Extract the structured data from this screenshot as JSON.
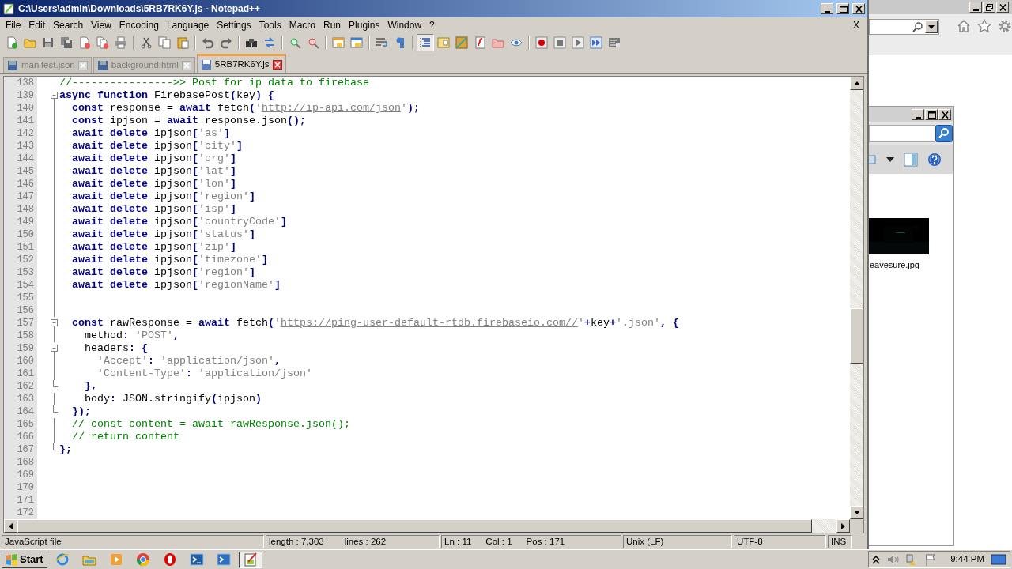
{
  "window": {
    "title": "C:\\Users\\admin\\Downloads\\5RB7RK6Y.js - Notepad++"
  },
  "menu": [
    "File",
    "Edit",
    "Search",
    "View",
    "Encoding",
    "Language",
    "Settings",
    "Tools",
    "Macro",
    "Run",
    "Plugins",
    "Window",
    "?"
  ],
  "menu_close": "X",
  "toolbar": [
    {
      "pressed": false
    },
    {
      "pressed": false
    },
    {
      "pressed": false
    },
    {
      "pressed": false
    },
    {
      "pressed": false
    },
    {
      "pressed": false
    },
    {
      "pressed": false
    },
    {
      "pressed": false
    },
    {
      "pressed": false
    },
    {
      "pressed": false
    },
    {
      "pressed": false
    },
    {
      "pressed": false
    },
    {
      "pressed": false
    },
    {
      "pressed": false
    },
    {
      "pressed": false
    },
    {
      "pressed": false
    },
    {
      "pressed": false
    },
    {
      "pressed": false
    },
    {
      "pressed": false
    },
    {
      "pressed": false
    },
    {
      "pressed": true
    },
    {
      "pressed": false
    },
    {
      "pressed": false
    },
    {
      "pressed": false
    },
    {
      "pressed": false
    },
    {
      "pressed": false
    },
    {
      "pressed": false
    },
    {
      "pressed": false
    },
    {
      "pressed": false
    },
    {
      "pressed": false
    },
    {
      "pressed": false
    }
  ],
  "tabs": [
    {
      "label": "manifest.json",
      "selected": false
    },
    {
      "label": "background.html",
      "selected": false
    },
    {
      "label": "5RB7RK6Y.js",
      "selected": true
    }
  ],
  "editor": {
    "lines": [
      {
        "num": "138",
        "kind": "plain",
        "tokens": [
          {
            "kind": "comment",
            "text": "//---------------->> Post for ip data to firebase"
          }
        ]
      },
      {
        "num": "139",
        "kind": "start",
        "tokens": [
          {
            "kind": "keyword",
            "text": "async "
          },
          {
            "kind": "keyword",
            "text": "function"
          },
          {
            "kind": "plain",
            "text": " FirebasePost"
          },
          {
            "kind": "operator",
            "text": "("
          },
          {
            "kind": "plain",
            "text": "key"
          },
          {
            "kind": "operator",
            "text": ") {"
          }
        ]
      },
      {
        "num": "140",
        "kind": "inner",
        "tokens": [
          {
            "kind": "keyword",
            "text": "  const"
          },
          {
            "kind": "plain",
            "text": " response = "
          },
          {
            "kind": "keyword",
            "text": "await"
          },
          {
            "kind": "plain",
            "text": " fetch"
          },
          {
            "kind": "operator",
            "text": "("
          },
          {
            "kind": "string",
            "text": "'"
          },
          {
            "kind": "url",
            "text": "http://ip-api.com/json"
          },
          {
            "kind": "string",
            "text": "'"
          },
          {
            "kind": "operator",
            "text": ");"
          }
        ]
      },
      {
        "num": "141",
        "kind": "inner",
        "tokens": [
          {
            "kind": "keyword",
            "text": "  const"
          },
          {
            "kind": "plain",
            "text": " ipjson = "
          },
          {
            "kind": "keyword",
            "text": "await"
          },
          {
            "kind": "plain",
            "text": " response.json"
          },
          {
            "kind": "operator",
            "text": "();"
          }
        ]
      },
      {
        "num": "142",
        "kind": "inner",
        "tokens": [
          {
            "kind": "keyword",
            "text": "  await "
          },
          {
            "kind": "keyword",
            "text": "delete"
          },
          {
            "kind": "plain",
            "text": " ipjson"
          },
          {
            "kind": "operator",
            "text": "["
          },
          {
            "kind": "string",
            "text": "'as'"
          },
          {
            "kind": "operator",
            "text": "]"
          }
        ]
      },
      {
        "num": "143",
        "kind": "inner",
        "tokens": [
          {
            "kind": "keyword",
            "text": "  await "
          },
          {
            "kind": "keyword",
            "text": "delete"
          },
          {
            "kind": "plain",
            "text": " ipjson"
          },
          {
            "kind": "operator",
            "text": "["
          },
          {
            "kind": "string",
            "text": "'city'"
          },
          {
            "kind": "operator",
            "text": "]"
          }
        ]
      },
      {
        "num": "144",
        "kind": "inner",
        "tokens": [
          {
            "kind": "keyword",
            "text": "  await "
          },
          {
            "kind": "keyword",
            "text": "delete"
          },
          {
            "kind": "plain",
            "text": " ipjson"
          },
          {
            "kind": "operator",
            "text": "["
          },
          {
            "kind": "string",
            "text": "'org'"
          },
          {
            "kind": "operator",
            "text": "]"
          }
        ]
      },
      {
        "num": "145",
        "kind": "inner",
        "tokens": [
          {
            "kind": "keyword",
            "text": "  await "
          },
          {
            "kind": "keyword",
            "text": "delete"
          },
          {
            "kind": "plain",
            "text": " ipjson"
          },
          {
            "kind": "operator",
            "text": "["
          },
          {
            "kind": "string",
            "text": "'lat'"
          },
          {
            "kind": "operator",
            "text": "]"
          }
        ]
      },
      {
        "num": "146",
        "kind": "inner",
        "tokens": [
          {
            "kind": "keyword",
            "text": "  await "
          },
          {
            "kind": "keyword",
            "text": "delete"
          },
          {
            "kind": "plain",
            "text": " ipjson"
          },
          {
            "kind": "operator",
            "text": "["
          },
          {
            "kind": "string",
            "text": "'lon'"
          },
          {
            "kind": "operator",
            "text": "]"
          }
        ]
      },
      {
        "num": "147",
        "kind": "inner",
        "tokens": [
          {
            "kind": "keyword",
            "text": "  await "
          },
          {
            "kind": "keyword",
            "text": "delete"
          },
          {
            "kind": "plain",
            "text": " ipjson"
          },
          {
            "kind": "operator",
            "text": "["
          },
          {
            "kind": "string",
            "text": "'region'"
          },
          {
            "kind": "operator",
            "text": "]"
          }
        ]
      },
      {
        "num": "148",
        "kind": "inner",
        "tokens": [
          {
            "kind": "keyword",
            "text": "  await "
          },
          {
            "kind": "keyword",
            "text": "delete"
          },
          {
            "kind": "plain",
            "text": " ipjson"
          },
          {
            "kind": "operator",
            "text": "["
          },
          {
            "kind": "string",
            "text": "'isp'"
          },
          {
            "kind": "operator",
            "text": "]"
          }
        ]
      },
      {
        "num": "149",
        "kind": "inner",
        "tokens": [
          {
            "kind": "keyword",
            "text": "  await "
          },
          {
            "kind": "keyword",
            "text": "delete"
          },
          {
            "kind": "plain",
            "text": " ipjson"
          },
          {
            "kind": "operator",
            "text": "["
          },
          {
            "kind": "string",
            "text": "'countryCode'"
          },
          {
            "kind": "operator",
            "text": "]"
          }
        ]
      },
      {
        "num": "150",
        "kind": "inner",
        "tokens": [
          {
            "kind": "keyword",
            "text": "  await "
          },
          {
            "kind": "keyword",
            "text": "delete"
          },
          {
            "kind": "plain",
            "text": " ipjson"
          },
          {
            "kind": "operator",
            "text": "["
          },
          {
            "kind": "string",
            "text": "'status'"
          },
          {
            "kind": "operator",
            "text": "]"
          }
        ]
      },
      {
        "num": "151",
        "kind": "inner",
        "tokens": [
          {
            "kind": "keyword",
            "text": "  await "
          },
          {
            "kind": "keyword",
            "text": "delete"
          },
          {
            "kind": "plain",
            "text": " ipjson"
          },
          {
            "kind": "operator",
            "text": "["
          },
          {
            "kind": "string",
            "text": "'zip'"
          },
          {
            "kind": "operator",
            "text": "]"
          }
        ]
      },
      {
        "num": "152",
        "kind": "inner",
        "tokens": [
          {
            "kind": "keyword",
            "text": "  await "
          },
          {
            "kind": "keyword",
            "text": "delete"
          },
          {
            "kind": "plain",
            "text": " ipjson"
          },
          {
            "kind": "operator",
            "text": "["
          },
          {
            "kind": "string",
            "text": "'timezone'"
          },
          {
            "kind": "operator",
            "text": "]"
          }
        ]
      },
      {
        "num": "153",
        "kind": "inner",
        "tokens": [
          {
            "kind": "keyword",
            "text": "  await "
          },
          {
            "kind": "keyword",
            "text": "delete"
          },
          {
            "kind": "plain",
            "text": " ipjson"
          },
          {
            "kind": "operator",
            "text": "["
          },
          {
            "kind": "string",
            "text": "'region'"
          },
          {
            "kind": "operator",
            "text": "]"
          }
        ]
      },
      {
        "num": "154",
        "kind": "inner",
        "tokens": [
          {
            "kind": "keyword",
            "text": "  await "
          },
          {
            "kind": "keyword",
            "text": "delete"
          },
          {
            "kind": "plain",
            "text": " ipjson"
          },
          {
            "kind": "operator",
            "text": "["
          },
          {
            "kind": "string",
            "text": "'regionName'"
          },
          {
            "kind": "operator",
            "text": "]"
          }
        ]
      },
      {
        "num": "155",
        "kind": "inner"
      },
      {
        "num": "156",
        "kind": "inner"
      },
      {
        "num": "157",
        "kind": "start",
        "tokens": [
          {
            "kind": "keyword",
            "text": "  const"
          },
          {
            "kind": "plain",
            "text": " rawResponse = "
          },
          {
            "kind": "keyword",
            "text": "await"
          },
          {
            "kind": "plain",
            "text": " fetch"
          },
          {
            "kind": "operator",
            "text": "("
          },
          {
            "kind": "string",
            "text": "'"
          },
          {
            "kind": "url",
            "text": "https://ping-user-default-rtdb.firebaseio.com//"
          },
          {
            "kind": "string",
            "text": "'"
          },
          {
            "kind": "operator",
            "text": "+"
          },
          {
            "kind": "plain",
            "text": "key"
          },
          {
            "kind": "operator",
            "text": "+"
          },
          {
            "kind": "string",
            "text": "'.json'"
          },
          {
            "kind": "operator",
            "text": ", {"
          }
        ]
      },
      {
        "num": "158",
        "kind": "inner",
        "tokens": [
          {
            "kind": "plain",
            "text": "    method"
          },
          {
            "kind": "operator",
            "text": ": "
          },
          {
            "kind": "string",
            "text": "'POST'"
          },
          {
            "kind": "operator",
            "text": ","
          }
        ]
      },
      {
        "num": "159",
        "kind": "start",
        "tokens": [
          {
            "kind": "plain",
            "text": "    headers"
          },
          {
            "kind": "operator",
            "text": ": {"
          }
        ]
      },
      {
        "num": "160",
        "kind": "inner",
        "tokens": [
          {
            "kind": "string",
            "text": "      'Accept'"
          },
          {
            "kind": "operator",
            "text": ": "
          },
          {
            "kind": "string",
            "text": "'application/json'"
          },
          {
            "kind": "operator",
            "text": ","
          }
        ]
      },
      {
        "num": "161",
        "kind": "inner",
        "tokens": [
          {
            "kind": "string",
            "text": "      'Content-Type'"
          },
          {
            "kind": "operator",
            "text": ": "
          },
          {
            "kind": "string",
            "text": "'application/json'"
          }
        ]
      },
      {
        "num": "162",
        "kind": "end",
        "tokens": [
          {
            "kind": "operator",
            "text": "    },"
          }
        ]
      },
      {
        "num": "163",
        "kind": "inner",
        "tokens": [
          {
            "kind": "plain",
            "text": "    body"
          },
          {
            "kind": "operator",
            "text": ":"
          },
          {
            "kind": "plain",
            "text": " JSON.stringify"
          },
          {
            "kind": "operator",
            "text": "("
          },
          {
            "kind": "plain",
            "text": "ipjson"
          },
          {
            "kind": "operator",
            "text": ")"
          }
        ]
      },
      {
        "num": "164",
        "kind": "end",
        "tokens": [
          {
            "kind": "operator",
            "text": "  });"
          }
        ]
      },
      {
        "num": "165",
        "kind": "inner",
        "tokens": [
          {
            "kind": "comment",
            "text": "  // const content = await rawResponse.json();"
          }
        ]
      },
      {
        "num": "166",
        "kind": "inner",
        "tokens": [
          {
            "kind": "comment",
            "text": "  // return content"
          }
        ]
      },
      {
        "num": "167",
        "kind": "end",
        "tokens": [
          {
            "kind": "operator",
            "text": "};"
          }
        ]
      },
      {
        "num": "168",
        "kind": "plain"
      },
      {
        "num": "169",
        "kind": "plain"
      },
      {
        "num": "170",
        "kind": "plain"
      },
      {
        "num": "171",
        "kind": "plain"
      },
      {
        "num": "172",
        "kind": "plain"
      }
    ]
  },
  "status_bar": {
    "file_type": "JavaScript file",
    "length": "length : 7,303",
    "lines": "lines : 262",
    "ln": "Ln : 11",
    "col": "Col : 1",
    "pos": "Pos : 171",
    "eol": "Unix (LF)",
    "encoding": "UTF-8",
    "mode": "INS"
  },
  "explorer": {
    "file_name": "eavesure.jpg"
  },
  "taskbar": {
    "start": "Start",
    "apps": [
      {
        "active": false
      },
      {
        "active": false
      },
      {
        "active": false
      },
      {
        "active": false
      },
      {
        "active": false
      },
      {
        "active": false
      },
      {
        "active": false
      },
      {
        "active": true
      }
    ],
    "clock": "9:44 PM"
  }
}
